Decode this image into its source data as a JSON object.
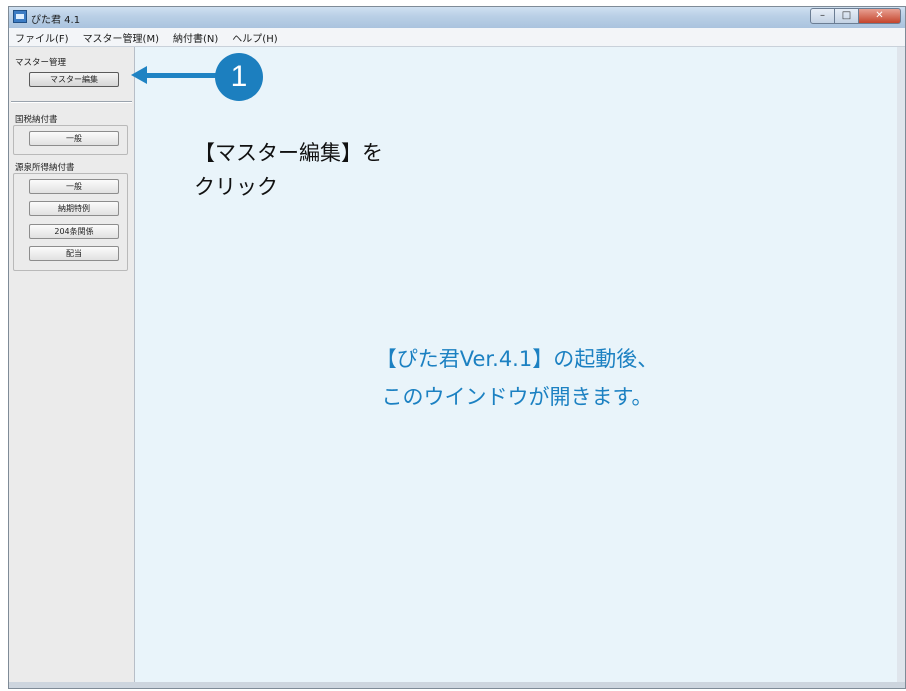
{
  "window": {
    "title": "ぴた君 4.1",
    "controls": {
      "minimize": "–",
      "maximize": "□",
      "close": "✕"
    }
  },
  "menu": [
    "ファイル(F)",
    "マスター管理(M)",
    "納付書(N)",
    "ヘルプ(H)"
  ],
  "sidebar": {
    "master_section": {
      "label": "マスター管理",
      "button": "マスター編集"
    },
    "national_tax_section": {
      "label": "国税納付書",
      "button": "一般"
    },
    "withholding_section": {
      "label": "源泉所得納付書",
      "buttons": [
        "一般",
        "納期特例",
        "204条関係",
        "配当"
      ]
    }
  },
  "callout": {
    "step_number": "1",
    "line1": "【マスター編集】を",
    "line2": "クリック"
  },
  "main_message": {
    "line1": "【ぴた君Ver.4.1】の起動後、",
    "line2": "このウインドウが開きます。"
  },
  "colors": {
    "accent": "#1c81c2",
    "main_background": "#e9f4fa"
  },
  "icons": {
    "app": "app-icon",
    "arrow": "arrow-left-icon"
  }
}
